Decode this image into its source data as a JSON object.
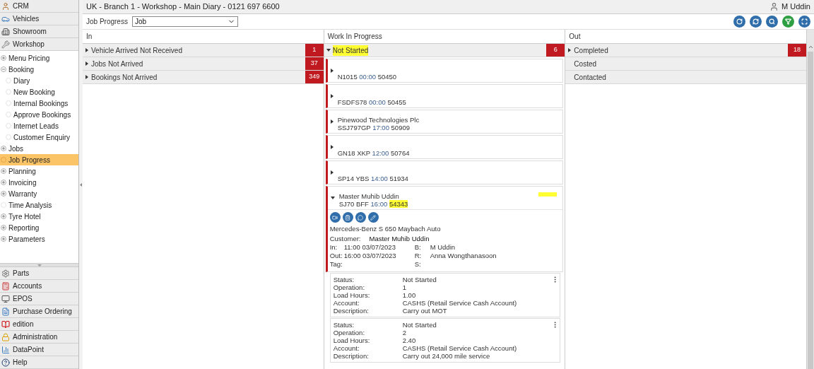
{
  "header": {
    "title": "UK - Branch 1 - Workshop - Main Diary - 0121 697 6600",
    "user": "M Uddin"
  },
  "toolbar": {
    "label": "Job Progress",
    "select_value": "Job"
  },
  "sidebar": {
    "modules_top": [
      "CRM",
      "Vehicles",
      "Showroom",
      "Workshop"
    ],
    "tree": [
      {
        "label": "Menu Pricing",
        "expandable": true,
        "expanded": false,
        "selected": false
      },
      {
        "label": "Booking",
        "expandable": true,
        "expanded": true,
        "selected": false,
        "children": [
          {
            "label": "Diary",
            "expandable": false,
            "selected": false
          },
          {
            "label": "New Booking",
            "expandable": false,
            "selected": false
          },
          {
            "label": "Internal Bookings",
            "expandable": false,
            "selected": false
          },
          {
            "label": "Approve Bookings",
            "expandable": false,
            "selected": false
          },
          {
            "label": "Internet Leads",
            "expandable": false,
            "selected": false
          },
          {
            "label": "Customer Enquiry",
            "expandable": false,
            "selected": false
          }
        ]
      },
      {
        "label": "Jobs",
        "expandable": true,
        "expanded": false,
        "selected": false
      },
      {
        "label": "Job Progress",
        "expandable": false,
        "selected": true
      },
      {
        "label": "Planning",
        "expandable": true,
        "expanded": false,
        "selected": false
      },
      {
        "label": "Invoicing",
        "expandable": true,
        "expanded": false,
        "selected": false
      },
      {
        "label": "Warranty",
        "expandable": true,
        "expanded": false,
        "selected": false
      },
      {
        "label": "Time Analysis",
        "expandable": false,
        "selected": false
      },
      {
        "label": "Tyre Hotel",
        "expandable": true,
        "expanded": false,
        "selected": false
      },
      {
        "label": "Reporting",
        "expandable": true,
        "expanded": false,
        "selected": false
      },
      {
        "label": "Parameters",
        "expandable": true,
        "expanded": false,
        "selected": false
      }
    ],
    "modules_bottom": [
      "Parts",
      "Accounts",
      "EPOS",
      "Purchase Ordering",
      "edition",
      "Administration",
      "DataPoint",
      "Help"
    ]
  },
  "columns": [
    {
      "title": "In",
      "groups": [
        {
          "label": "Vehicle Arrived Not Received",
          "count": "1",
          "expandable": true,
          "expanded": false,
          "highlighted": false
        },
        {
          "label": "Jobs Not Arrived",
          "count": "37",
          "expandable": true,
          "expanded": false,
          "highlighted": false
        },
        {
          "label": "Bookings Not Arrived",
          "count": "349",
          "expandable": true,
          "expanded": false,
          "highlighted": false
        }
      ]
    },
    {
      "title": "Work In Progress",
      "groups": [
        {
          "label": "Not Started",
          "count": "6",
          "expandable": true,
          "expanded": true,
          "highlighted": true,
          "jobs": [
            {
              "reg": "N1015",
              "time": "00:00",
              "ref": "50450",
              "expanded": false,
              "highlighted": false
            },
            {
              "reg": "FSDFS78",
              "time": "00:00",
              "ref": "50455",
              "expanded": false,
              "highlighted": false
            },
            {
              "customer": "Pinewood Technologies Plc",
              "reg": "SSJ797GP",
              "time": "17:00",
              "ref": "50909",
              "expanded": false,
              "highlighted": false
            },
            {
              "reg": "GN18 XKP",
              "time": "12:00",
              "ref": "50764",
              "expanded": false,
              "highlighted": false
            },
            {
              "reg": "SP14 YBS",
              "time": "14:00",
              "ref": "51934",
              "expanded": false,
              "highlighted": false
            },
            {
              "customer": "Master Muhib Uddin",
              "reg": "SJ70 BFF",
              "time": "16:00",
              "ref": "54343",
              "expanded": true,
              "highlighted": true,
              "detail": {
                "vehicle": "Mercedes-Benz S 650 Maybach Auto",
                "customer_label": "Customer:",
                "customer_value": "Master Muhib Uddin",
                "rows": [
                  {
                    "label": "In:",
                    "value": "11:00 03/07/2023",
                    "label2": "B:",
                    "value2": "M Uddin"
                  },
                  {
                    "label": "Out:",
                    "value": "16:00 03/07/2023",
                    "label2": "R:",
                    "value2": "Anna Wongthanasoon"
                  },
                  {
                    "label": "Tag:",
                    "label2": "S:"
                  }
                ],
                "operations": [
                  [
                    {
                      "label": "Status:",
                      "value": "Not Started"
                    },
                    {
                      "label": "Operation:",
                      "value": "1"
                    },
                    {
                      "label": "Load Hours:",
                      "value": "1.00"
                    },
                    {
                      "label": "Account:",
                      "value": "CASHS (Retail Service Cash Account)"
                    },
                    {
                      "label": "Description:",
                      "value": "Carry out MOT"
                    }
                  ],
                  [
                    {
                      "label": "Status:",
                      "value": "Not Started"
                    },
                    {
                      "label": "Operation:",
                      "value": "2"
                    },
                    {
                      "label": "Load Hours:",
                      "value": "2.40"
                    },
                    {
                      "label": "Account:",
                      "value": "CASHS (Retail Service Cash Account)"
                    },
                    {
                      "label": "Description:",
                      "value": "Carry out 24,000 mile service"
                    }
                  ]
                ]
              }
            }
          ]
        }
      ]
    },
    {
      "title": "Out",
      "groups": [
        {
          "label": "Completed",
          "count": "18",
          "expandable": true,
          "expanded": false,
          "highlighted": false
        },
        {
          "label": "Costed",
          "expandable": false,
          "highlighted": false
        },
        {
          "label": "Contacted",
          "expandable": false,
          "highlighted": false
        }
      ]
    }
  ]
}
